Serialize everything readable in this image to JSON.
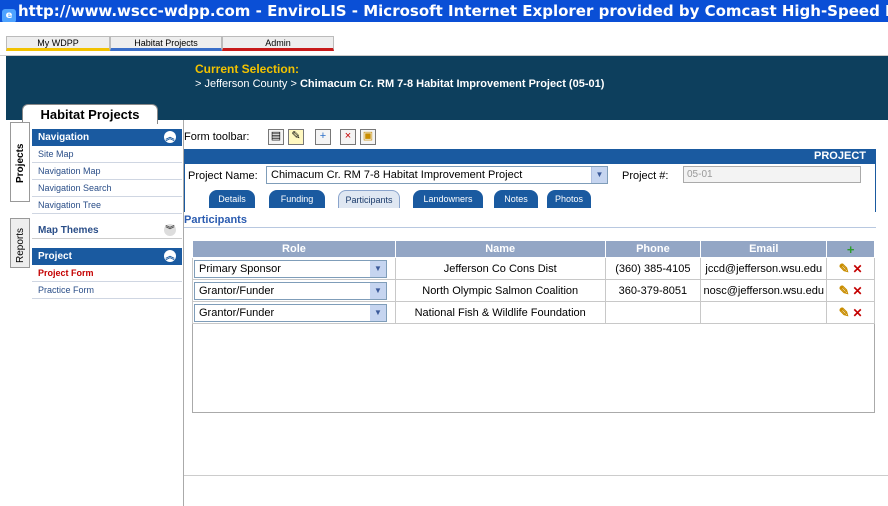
{
  "window": {
    "title": "http://www.wscc-wdpp.com - EnviroLIS - Microsoft Internet Explorer provided by Comcast High-Speed Intern"
  },
  "topnav": {
    "tabs": [
      "My WDPP",
      "Habitat Projects",
      "Admin"
    ]
  },
  "banner": {
    "current_label": "Current Selection:",
    "path_prefix": "> Jefferson County > ",
    "path_bold": "Chimacum Cr. RM 7-8 Habitat Improvement Project (05-01)"
  },
  "sidebar": {
    "title": "Habitat Projects",
    "vtabs": [
      "Projects",
      "Reports"
    ],
    "navigation": {
      "header": "Navigation",
      "items": [
        "Site Map",
        "Navigation Map",
        "Navigation Search",
        "Navigation Tree"
      ]
    },
    "map_themes": {
      "header": "Map Themes"
    },
    "project": {
      "header": "Project",
      "items": [
        "Project Form",
        "Practice Form"
      ]
    }
  },
  "form": {
    "toolbar_label": "Form toolbar:",
    "section_title": "PROJECT",
    "project_name_label": "Project Name:",
    "project_name_value": "Chimacum Cr. RM 7-8 Habitat Improvement Project",
    "project_num_label": "Project #:",
    "project_num_value": "05-01",
    "tabs": [
      "Details",
      "Funding",
      "Participants",
      "Landowners",
      "Notes",
      "Photos"
    ],
    "active_tab": "Participants",
    "participants_label": "Participants"
  },
  "participants_table": {
    "headers": [
      "Role",
      "Name",
      "Phone",
      "Email"
    ],
    "rows": [
      {
        "role": "Primary Sponsor",
        "name": "Jefferson Co Cons Dist",
        "phone": "(360) 385-4105",
        "email": "jccd@jefferson.wsu.edu"
      },
      {
        "role": "Grantor/Funder",
        "name": "North Olympic Salmon Coalition",
        "phone": "360-379-8051",
        "email": "nosc@jefferson.wsu.edu"
      },
      {
        "role": "Grantor/Funder",
        "name": "National Fish & Wildlife Foundation",
        "phone": "",
        "email": ""
      }
    ]
  },
  "colors": {
    "titlebar": "#0a4fd6",
    "banner": "#0d3f5d",
    "accent_blue": "#1a5aa0",
    "active_red": "#c40000",
    "current_yellow": "#f2c200"
  }
}
